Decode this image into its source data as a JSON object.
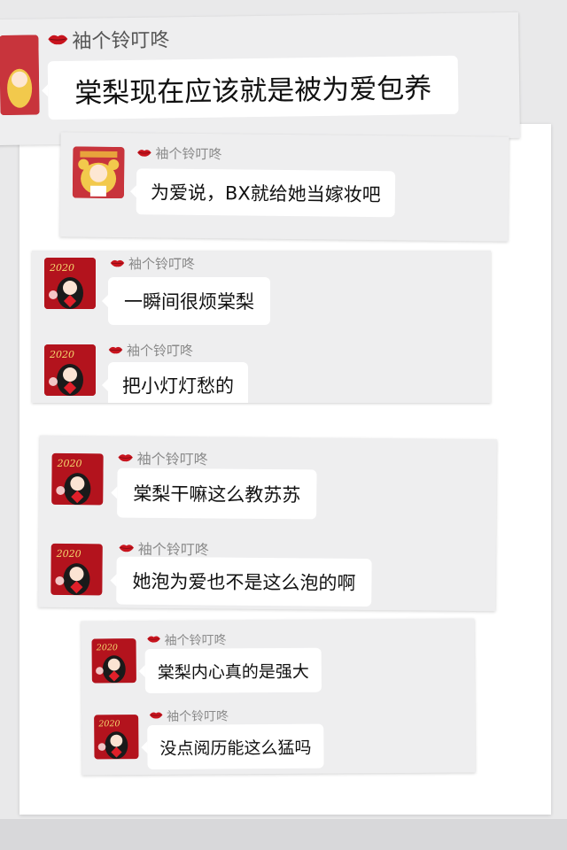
{
  "accent_red": "#b3131d",
  "lips_color": "#c8141e",
  "messages": [
    {
      "sender": "袖个铃叮咚",
      "text": "棠梨现在应该就是被为爱包养",
      "avatar": "sailor-moon-avatar"
    },
    {
      "sender": "袖个铃叮咚",
      "text": "为爱说，BX就给她当嫁妆吧",
      "avatar": "sailor-moon-avatar"
    },
    {
      "sender": "袖个铃叮咚",
      "text": "一瞬间很烦棠梨",
      "avatar": "girl-2020-avatar"
    },
    {
      "sender": "袖个铃叮咚",
      "text": "把小灯灯愁的",
      "avatar": "girl-2020-avatar"
    },
    {
      "sender": "袖个铃叮咚",
      "text": "棠梨干嘛这么教苏苏",
      "avatar": "girl-2020-avatar"
    },
    {
      "sender": "袖个铃叮咚",
      "text": "她泡为爱也不是这么泡的啊",
      "avatar": "girl-2020-avatar"
    },
    {
      "sender": "袖个铃叮咚",
      "text": "棠梨内心真的是强大",
      "avatar": "girl-2020-avatar"
    },
    {
      "sender": "袖个铃叮咚",
      "text": "没点阅历能这么猛吗",
      "avatar": "girl-2020-avatar"
    }
  ]
}
